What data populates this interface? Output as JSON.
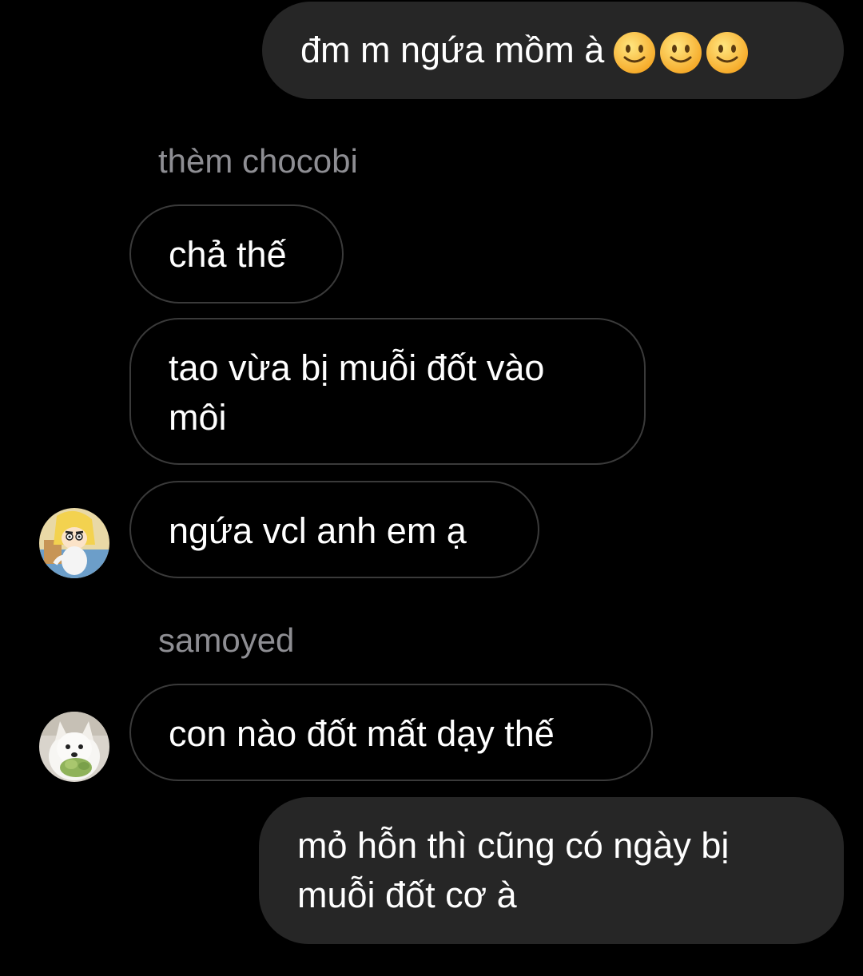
{
  "conversation": {
    "messages": [
      {
        "from": "me",
        "text": "đm m ngứa mồm à",
        "emoji": [
          "slightly-smiling-face",
          "slightly-smiling-face",
          "slightly-smiling-face"
        ]
      },
      {
        "from": "thèm chocobi",
        "sender_label": "thèm chocobi",
        "text": "chả thế"
      },
      {
        "from": "thèm chocobi",
        "text": "tao vừa bị muỗi đốt vào môi"
      },
      {
        "from": "thèm chocobi",
        "text": "ngứa vcl anh em ạ"
      },
      {
        "from": "samoyed",
        "sender_label": "samoyed",
        "text": "con nào đốt mất dạy thế"
      },
      {
        "from": "me",
        "text": "mỏ hỗn thì cũng có ngày bị muỗi đốt cơ à"
      }
    ]
  },
  "colors": {
    "background": "#000000",
    "outgoing_bubble": "#262626",
    "incoming_border": "#3a3a3a",
    "sender_label": "#8e8e93",
    "text": "#ffffff"
  },
  "avatars": {
    "user1_icon": "cartoon-character-avatar",
    "user2_icon": "samoyed-dog-avatar"
  }
}
